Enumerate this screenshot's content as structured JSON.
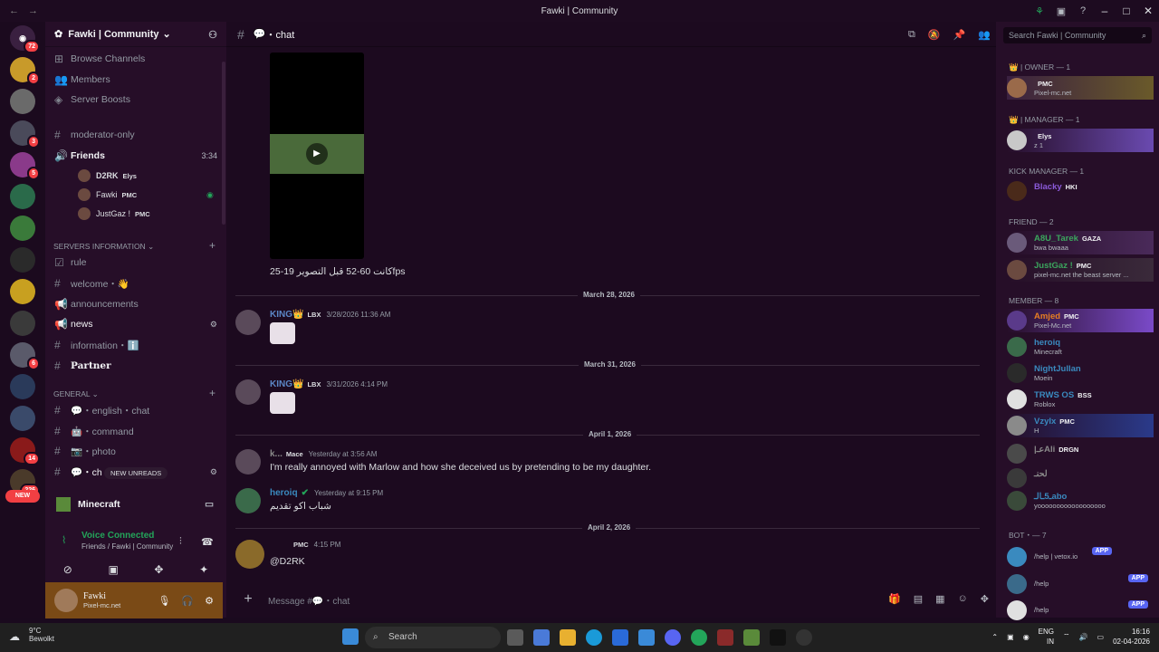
{
  "window": {
    "title": "Fawki | Community"
  },
  "rail": {
    "badges": [
      "72",
      "2",
      "3",
      "5",
      "6",
      "14",
      "226"
    ],
    "new_label": "NEW"
  },
  "guild": {
    "name": "Fawki | Community"
  },
  "nav": {
    "browse": "Browse Channels",
    "members": "Members",
    "boosts": "Server Boosts"
  },
  "channels": {
    "moderator": "moderator-only",
    "friends": "Friends",
    "friends_time": "3:34",
    "voice_users": [
      {
        "name": "D2RK",
        "tag": "Elys"
      },
      {
        "name": "Fawki",
        "tag": "PMC"
      },
      {
        "name": "JustGaz !",
        "tag": "PMC"
      }
    ],
    "cat_servers": "SERVERS INFORMATION",
    "rule": "rule",
    "welcome": "welcome・👋",
    "announcements": "announcements",
    "news": "news",
    "information": "information・ℹ️",
    "partner": "Partner",
    "cat_general": "GENERAL",
    "english_chat": "・english・chat",
    "command": "・command",
    "photo": "・photo",
    "last": "・ch",
    "new_unreads": "NEW UNREADS"
  },
  "bottom": {
    "minecraft": "Minecraft",
    "voice_connected": "Voice Connected",
    "voice_location": "Friends / Fawki | Community",
    "user_name": "Fawki",
    "user_status": "Pixel-mc.net"
  },
  "chat": {
    "header": "・chat",
    "video_caption": "كانت 60-52 قبل التصوير 19-25fps",
    "dates": [
      "March 28, 2026",
      "March 31, 2026",
      "April 1, 2026",
      "April 2, 2026"
    ],
    "messages": [
      {
        "name": "KING",
        "tag": "LBX",
        "time": "3/28/2026 11:36 AM",
        "color": "#5b87c7"
      },
      {
        "name": "KING",
        "tag": "LBX",
        "time": "3/31/2026 4:14 PM",
        "color": "#5b87c7"
      },
      {
        "name": "k...",
        "tag": "Mace",
        "time": "Yesterday at 3:56 AM",
        "text": "I'm really annoyed with Marlow and how she deceived us by pretending to be my daughter.",
        "color": "#8a8a8a"
      },
      {
        "name": "heroiq",
        "tag": "",
        "time": "Yesterday at 9:15 PM",
        "text": "شباب اكو تقديم",
        "color": "#3a8abf"
      },
      {
        "name": "",
        "tag": "PMC",
        "time": "4:15 PM",
        "text": "@D2RK",
        "color": "#f2f3f5"
      }
    ],
    "composer_placeholder": "Message #💬・chat"
  },
  "members": {
    "search_placeholder": "Search Fawki | Community",
    "groups": [
      {
        "label": "| OWNER — 1"
      },
      {
        "label": "| MANAGER — 1"
      },
      {
        "label": "KICK Manager — 1"
      },
      {
        "label": "Friend — 2"
      },
      {
        "label": "Member — 8"
      },
      {
        "label": "BOT・— 7"
      }
    ],
    "list": [
      {
        "name": "",
        "tag": "PMC",
        "status": "Pixel-mc.net",
        "color": "#3ba55d"
      },
      {
        "name": "",
        "tag": "Elys",
        "status": "z 1",
        "color": "#f23f43"
      },
      {
        "name": "Blacky",
        "tag": "HKI",
        "status": "",
        "color": "#8a5ad8"
      },
      {
        "name": "A8U_Tarek",
        "tag": "GAZA",
        "status": "bwa bwaaa",
        "color": "#3ba55d"
      },
      {
        "name": "JustGaz !",
        "tag": "PMC",
        "status": "pixel-mc.net the beast server ...",
        "color": "#3ba55d"
      },
      {
        "name": "Amjed",
        "tag": "PMC",
        "status": "Pixel-Mc.net",
        "color": "#e67e22"
      },
      {
        "name": "heroiq",
        "tag": "",
        "status": "Minecraft",
        "color": "#3a8abf"
      },
      {
        "name": "NightJullan",
        "tag": "",
        "status": "Moein",
        "color": "#3a8abf"
      },
      {
        "name": "TRWS OS",
        "tag": "BSS",
        "status": "Roblox",
        "color": "#3a8abf"
      },
      {
        "name": "Vzylx",
        "tag": "PMC",
        "status": "H",
        "color": "#3a8abf"
      },
      {
        "name": "|عـAli",
        "tag": "DRGN",
        "status": "",
        "color": "#8a8a8a"
      },
      {
        "name": "لحنـ",
        "tag": "",
        "status": "",
        "color": "#8a8a8a"
      },
      {
        "name": "ـ5ـالـabo",
        "tag": "",
        "status": "yoooooooooooooooooo",
        "color": "#3a8abf"
      }
    ],
    "bots": [
      {
        "status": "/help | vetox.io",
        "badge": "APP"
      },
      {
        "status": "/help",
        "badge": "APP"
      },
      {
        "status": "/help",
        "badge": "APP"
      }
    ]
  },
  "taskbar": {
    "weather_temp": "9°C",
    "weather_desc": "Bewolkt",
    "search": "Search",
    "lang1": "ENG",
    "lang2": "IN",
    "time": "16:16",
    "date": "02-04-2026"
  }
}
